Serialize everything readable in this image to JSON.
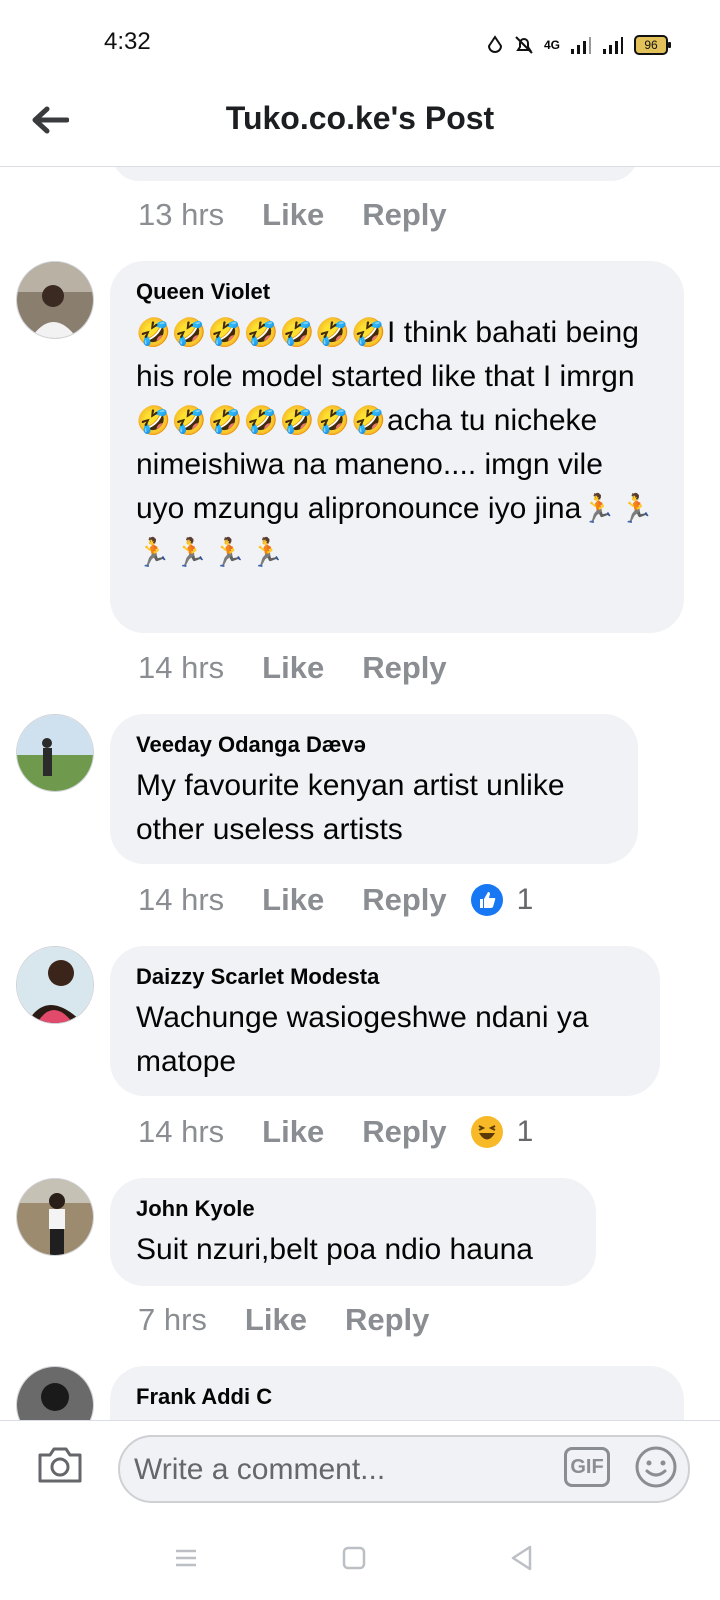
{
  "status_bar": {
    "time": "4:32",
    "battery": "96",
    "network": "4G"
  },
  "header": {
    "title": "Tuko.co.ke's Post"
  },
  "comments": [
    {
      "name": "",
      "text": "",
      "time": "13 hrs",
      "like": "Like",
      "reply": "Reply"
    },
    {
      "name": "Queen Violet",
      "emoji_laugh_run1": "🤣🤣🤣🤣🤣🤣🤣",
      "line1": "I think bahati being his role model started like that I imrgn",
      "emoji_laugh_run2": "🤣🤣🤣🤣🤣🤣🤣",
      "line2": "acha tu nicheke nimeishiwa na maneno.... imgn vile uyo mzungu alipronounce iyo jina",
      "emoji_run_row": "🏃🏃🏃🏃🏃🏃",
      "time": "14 hrs",
      "like": "Like",
      "reply": "Reply"
    },
    {
      "name": "Veeday Odanga Dævə",
      "text": "My favourite kenyan artist unlike other useless artists",
      "time": "14 hrs",
      "like": "Like",
      "reply": "Reply",
      "reaction": {
        "type": "like-icon",
        "count": "1"
      }
    },
    {
      "name": "Daizzy Scarlet Modesta",
      "text": "Wachunge wasiogeshwe ndani ya matope",
      "time": "14 hrs",
      "like": "Like",
      "reply": "Reply",
      "reaction": {
        "type": "haha-icon",
        "count": "1"
      }
    },
    {
      "name": "John Kyole",
      "text": "Suit nzuri,belt poa ndio hauna",
      "time": "7 hrs",
      "like": "Like",
      "reply": "Reply"
    },
    {
      "name": "Frank Addi C",
      "text": ""
    }
  ],
  "compose": {
    "placeholder": "Write a comment...",
    "gif_label": "GIF"
  },
  "colors": {
    "bubble": "#f0f2f5",
    "meta_text": "#8a8d91",
    "like_blue": "#1877f2",
    "haha_yellow": "#f7b928"
  }
}
